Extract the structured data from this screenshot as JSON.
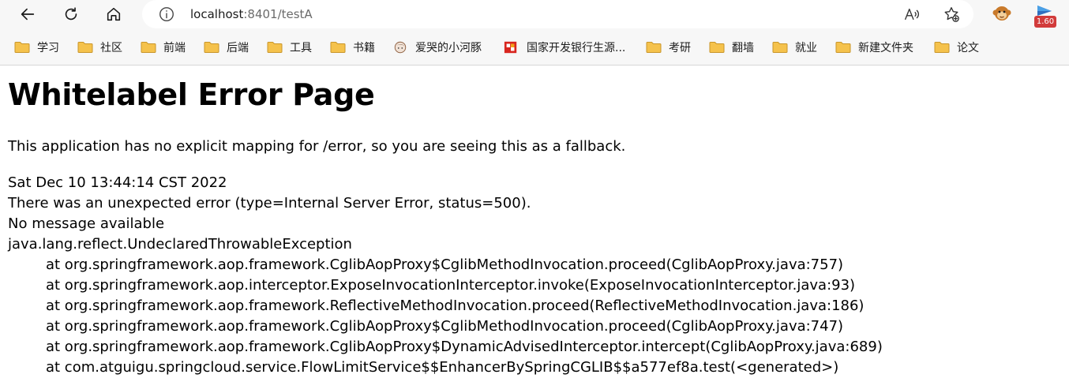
{
  "browser": {
    "address": {
      "host": "localhost",
      "port_path": ":8401/testA"
    },
    "extension_badge": "1.60",
    "bookmarks": [
      {
        "label": "学习",
        "icon": "folder-icon"
      },
      {
        "label": "社区",
        "icon": "folder-icon"
      },
      {
        "label": "前端",
        "icon": "folder-icon"
      },
      {
        "label": "后端",
        "icon": "folder-icon"
      },
      {
        "label": "工具",
        "icon": "folder-icon"
      },
      {
        "label": "书籍",
        "icon": "folder-icon"
      },
      {
        "label": "爱哭的小河豚",
        "icon": "avatar-icon"
      },
      {
        "label": "国家开发银行生源...",
        "icon": "bank-logo-icon"
      },
      {
        "label": "考研",
        "icon": "folder-icon"
      },
      {
        "label": "翻墙",
        "icon": "folder-icon"
      },
      {
        "label": "就业",
        "icon": "folder-icon"
      },
      {
        "label": "新建文件夹",
        "icon": "folder-icon"
      },
      {
        "label": "论文",
        "icon": "folder-icon"
      }
    ]
  },
  "page": {
    "title": "Whitelabel Error Page",
    "intro": "This application has no explicit mapping for /error, so you are seeing this as a fallback.",
    "timestamp": "Sat Dec 10 13:44:14 CST 2022",
    "error_line": "There was an unexpected error (type=Internal Server Error, status=500).",
    "message": "No message available",
    "exception": "java.lang.reflect.UndeclaredThrowableException",
    "stack_trace": [
      "at org.springframework.aop.framework.CglibAopProxy$CglibMethodInvocation.proceed(CglibAopProxy.java:757)",
      "at org.springframework.aop.interceptor.ExposeInvocationInterceptor.invoke(ExposeInvocationInterceptor.java:93)",
      "at org.springframework.aop.framework.ReflectiveMethodInvocation.proceed(ReflectiveMethodInvocation.java:186)",
      "at org.springframework.aop.framework.CglibAopProxy$CglibMethodInvocation.proceed(CglibAopProxy.java:747)",
      "at org.springframework.aop.framework.CglibAopProxy$DynamicAdvisedInterceptor.intercept(CglibAopProxy.java:689)",
      "at com.atguigu.springcloud.service.FlowLimitService$$EnhancerBySpringCGLIB$$a577ef8a.test(<generated>)"
    ]
  },
  "colors": {
    "chrome_bg": "#f7f7f7",
    "folder_yellow": "#f5c24c",
    "badge_red": "#d23b3b"
  }
}
